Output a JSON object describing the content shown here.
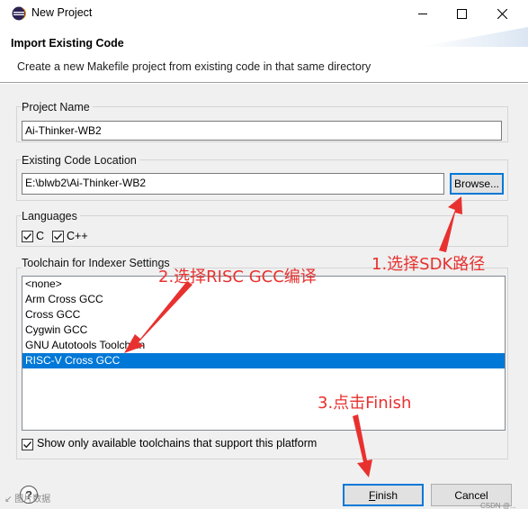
{
  "window": {
    "title": "New Project",
    "controls": {
      "minimize_icon": "minimize-icon",
      "maximize_icon": "maximize-icon",
      "close_icon": "close-icon"
    }
  },
  "header": {
    "title": "Import Existing Code",
    "description": "Create a new Makefile project from existing code in that same directory"
  },
  "project_name": {
    "label": "Project Name",
    "value": "Ai-Thinker-WB2"
  },
  "code_location": {
    "label": "Existing Code Location",
    "value": "E:\\blwb2\\Ai-Thinker-WB2",
    "browse_label": "Browse..."
  },
  "languages": {
    "label": "Languages",
    "items": [
      {
        "label": "C",
        "checked": true
      },
      {
        "label": "C++",
        "checked": true
      }
    ]
  },
  "toolchain": {
    "label": "Toolchain for Indexer Settings",
    "items": [
      "<none>",
      "Arm Cross GCC",
      "Cross GCC",
      "Cygwin GCC",
      "GNU Autotools Toolchain",
      "RISC-V Cross GCC"
    ],
    "selected": "RISC-V Cross GCC",
    "show_only_label": "Show only available toolchains that support this platform",
    "show_only_checked": true
  },
  "footer": {
    "finish_label": "Finish",
    "cancel_label": "Cancel",
    "help_glyph": "?",
    "watermark": "CSDN @...",
    "watermark_left": "↙ 图片数据"
  },
  "annotations": [
    {
      "text": "1.选择SDK路径"
    },
    {
      "text": "2.选择RISC GCC编译"
    },
    {
      "text": "3.点击Finish"
    }
  ],
  "colors": {
    "accent": "#0078d7",
    "annotation": "#e8312f"
  }
}
